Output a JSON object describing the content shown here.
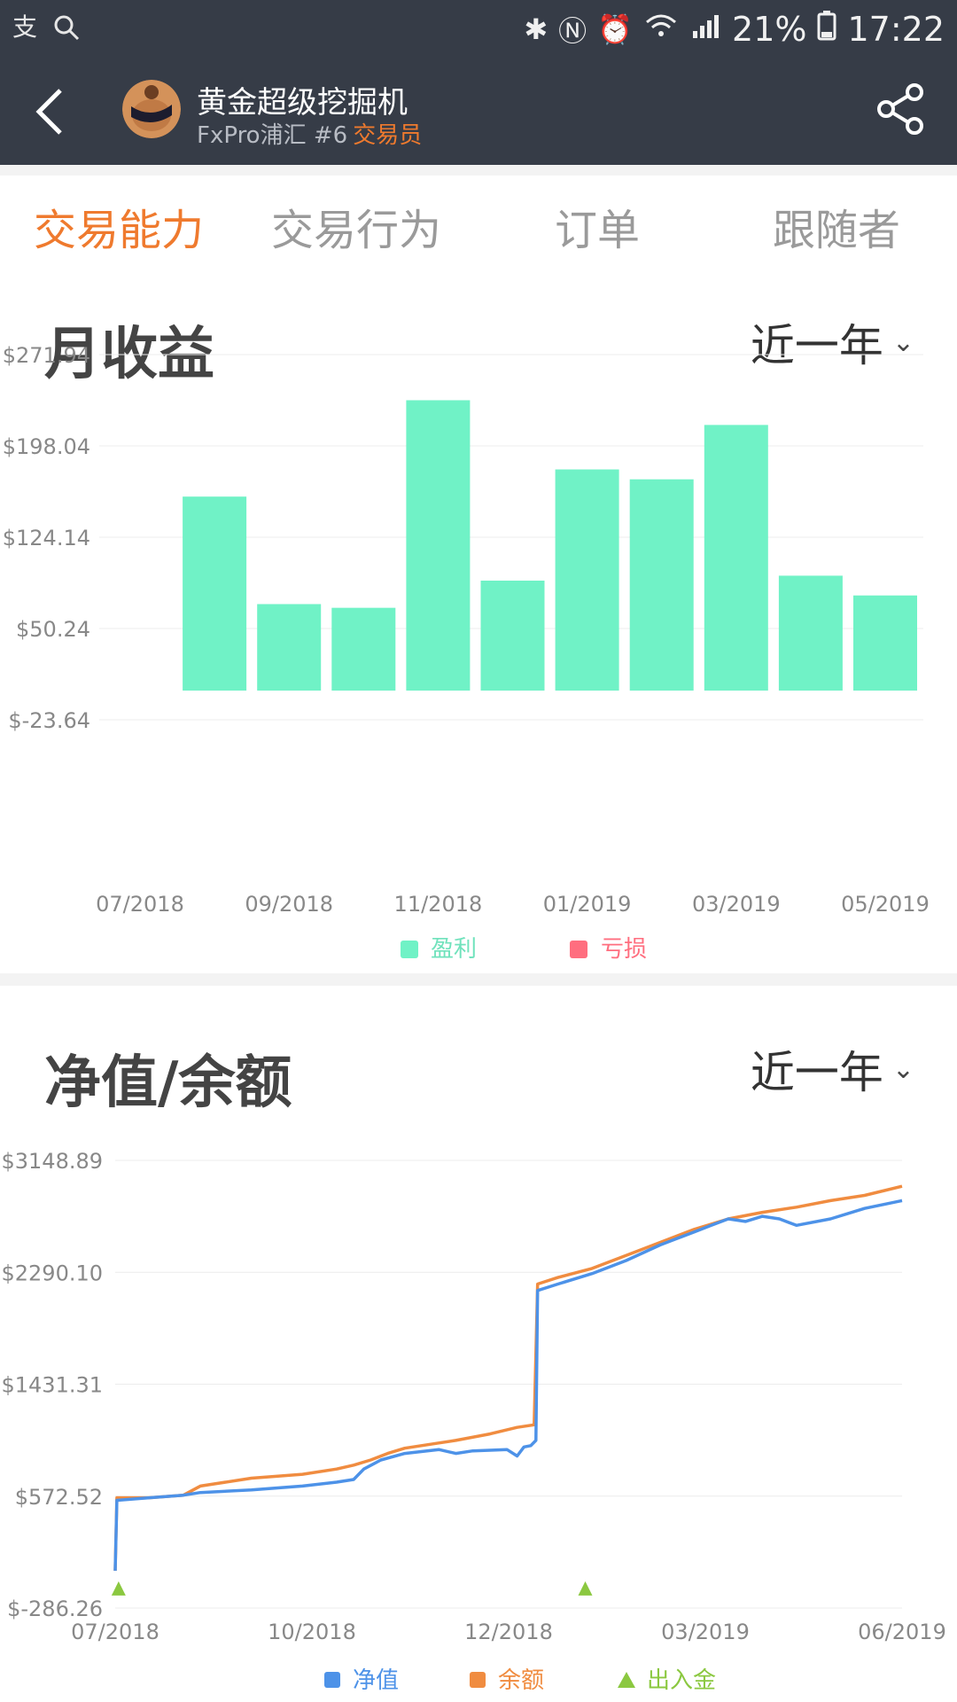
{
  "status": {
    "left_icons": [
      "alipay-icon",
      "search-icon"
    ],
    "battery": "21%",
    "time": "17:22"
  },
  "header": {
    "title": "黄金超级挖掘机",
    "subtitle": "FxPro浦汇 #6",
    "role": "交易员"
  },
  "tabs": [
    {
      "label": "交易能力",
      "active": true
    },
    {
      "label": "交易行为",
      "active": false
    },
    {
      "label": "订单",
      "active": false
    },
    {
      "label": "跟随者",
      "active": false
    }
  ],
  "monthly": {
    "title": "月收益",
    "range": "近一年",
    "legend": {
      "profit": "盈利",
      "loss": "亏损"
    },
    "colors": {
      "profit": "#70f2c6",
      "loss": "#ff6e7f"
    }
  },
  "equity": {
    "title": "净值/余额",
    "range": "近一年",
    "legend": {
      "equity": "净值",
      "balance": "余额",
      "deposit": "出入金"
    },
    "colors": {
      "equity": "#4d92e8",
      "balance": "#f08c40",
      "deposit": "#8bc840"
    }
  },
  "chart_data": [
    {
      "type": "bar",
      "y_ticks": [
        "$271.94",
        "$198.04",
        "$124.14",
        "$50.24",
        "$-23.64"
      ],
      "x_ticks": [
        "07/2018",
        "09/2018",
        "11/2018",
        "01/2019",
        "03/2019",
        "05/2019"
      ],
      "categories": [
        "07/2018",
        "08/2018",
        "09/2018",
        "10/2018",
        "11/2018",
        "12/2018",
        "01/2019",
        "02/2019",
        "03/2019",
        "04/2019",
        "05/2019"
      ],
      "series": [
        {
          "name": "盈利",
          "values": [
            0,
            157,
            70,
            67,
            235,
            89,
            179,
            171,
            215,
            93,
            77
          ]
        },
        {
          "name": "亏损",
          "values": [
            0,
            0,
            0,
            0,
            0,
            0,
            0,
            0,
            0,
            0,
            0
          ]
        }
      ],
      "ylim": [
        -23.64,
        271.94
      ]
    },
    {
      "type": "line",
      "y_ticks": [
        "$3148.89",
        "$2290.10",
        "$1431.31",
        "$572.52",
        "$-286.26"
      ],
      "x_ticks": [
        "07/2018",
        "10/2018",
        "12/2018",
        "03/2019",
        "06/2019"
      ],
      "ylim": [
        -286.26,
        3148.89
      ],
      "series": [
        {
          "name": "净值",
          "points": [
            [
              0,
              0
            ],
            [
              0.5,
              540
            ],
            [
              10,
              560
            ],
            [
              20,
              580
            ],
            [
              25,
              600
            ],
            [
              40,
              620
            ],
            [
              55,
              650
            ],
            [
              65,
              680
            ],
            [
              70,
              700
            ],
            [
              73,
              780
            ],
            [
              78,
              850
            ],
            [
              85,
              900
            ],
            [
              95,
              930
            ],
            [
              100,
              900
            ],
            [
              105,
              920
            ],
            [
              115,
              930
            ],
            [
              118,
              880
            ],
            [
              120,
              950
            ],
            [
              122,
              960
            ],
            [
              123.5,
              1000
            ],
            [
              124,
              2150
            ],
            [
              130,
              2200
            ],
            [
              140,
              2280
            ],
            [
              150,
              2380
            ],
            [
              160,
              2500
            ],
            [
              170,
              2600
            ],
            [
              175,
              2650
            ],
            [
              180,
              2700
            ],
            [
              185,
              2680
            ],
            [
              190,
              2720
            ],
            [
              195,
              2700
            ],
            [
              200,
              2650
            ],
            [
              210,
              2700
            ],
            [
              220,
              2780
            ],
            [
              231,
              2840
            ]
          ]
        },
        {
          "name": "余额",
          "points": [
            [
              0,
              0
            ],
            [
              0.5,
              560
            ],
            [
              10,
              560
            ],
            [
              20,
              580
            ],
            [
              25,
              650
            ],
            [
              40,
              710
            ],
            [
              55,
              740
            ],
            [
              65,
              780
            ],
            [
              70,
              810
            ],
            [
              75,
              850
            ],
            [
              80,
              900
            ],
            [
              85,
              940
            ],
            [
              95,
              980
            ],
            [
              100,
              1000
            ],
            [
              110,
              1050
            ],
            [
              118,
              1100
            ],
            [
              123,
              1120
            ],
            [
              124,
              2200
            ],
            [
              130,
              2250
            ],
            [
              140,
              2320
            ],
            [
              150,
              2420
            ],
            [
              160,
              2520
            ],
            [
              170,
              2620
            ],
            [
              180,
              2700
            ],
            [
              190,
              2750
            ],
            [
              200,
              2790
            ],
            [
              210,
              2840
            ],
            [
              220,
              2880
            ],
            [
              231,
              2950
            ]
          ]
        }
      ],
      "deposits": [
        [
          1,
          0
        ],
        [
          138,
          0
        ]
      ]
    }
  ]
}
